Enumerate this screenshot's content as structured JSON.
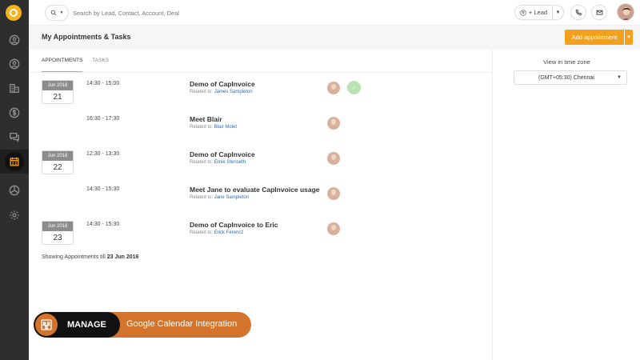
{
  "sidebar": {
    "items": [
      {
        "icon": "contact-icon"
      },
      {
        "icon": "user-icon"
      },
      {
        "icon": "building-icon"
      },
      {
        "icon": "dollar-icon"
      },
      {
        "icon": "chat-icon"
      },
      {
        "icon": "calendar-icon",
        "active": true
      },
      {
        "icon": "chart-icon"
      },
      {
        "icon": "gear-icon"
      }
    ]
  },
  "topbar": {
    "search_placeholder": "Search by Lead, Contact, Account, Deal",
    "lead_label": "+ Lead"
  },
  "header": {
    "title": "My Appointments & Tasks",
    "add_label": "Add appointment"
  },
  "tabs": [
    {
      "label": "APPOINTMENTS",
      "active": true
    },
    {
      "label": "TASKS",
      "active": false
    }
  ],
  "appointments": [
    {
      "month": "Jun 2016",
      "day": "21",
      "time": "14:30 - 15:00",
      "title": "Demo of CapInvoice",
      "related_prefix": "Related to:",
      "related": "James Sampleton",
      "done": true
    },
    {
      "month": "",
      "day": "",
      "time": "16:30 - 17:30",
      "title": "Meet Blair",
      "related_prefix": "Related to:",
      "related": "Blair Molet",
      "done": false
    },
    {
      "month": "Jun 2016",
      "day": "22",
      "time": "12:30 - 13:30",
      "title": "Demo of CapInvoice",
      "related_prefix": "Related to:",
      "related": "Ernie Stenseth",
      "done": false
    },
    {
      "month": "",
      "day": "",
      "time": "14:30 - 15:30",
      "title": "Meet Jane to evaluate CapInvoice usage",
      "related_prefix": "Related to:",
      "related": "Jane Sampleton",
      "done": false
    },
    {
      "month": "Jun 2016",
      "day": "23",
      "time": "14:30 - 15:30",
      "title": "Demo of CapInvoice to Eric",
      "related_prefix": "Related to:",
      "related": "Erick Ferencz",
      "done": false
    }
  ],
  "footer": {
    "showing_prefix": "Showing Appointments till",
    "showing_date": "23 Jun 2016"
  },
  "timezone": {
    "label": "View in time zone",
    "value": "(GMT+05:30) Chennai"
  },
  "banner": {
    "manage": "MANAGE",
    "text": "Google Calendar Integration"
  },
  "colors": {
    "accent": "#f2a11f",
    "sidebar": "#2e2e2e",
    "banner": "#d4732b",
    "link": "#2b6cb0"
  }
}
